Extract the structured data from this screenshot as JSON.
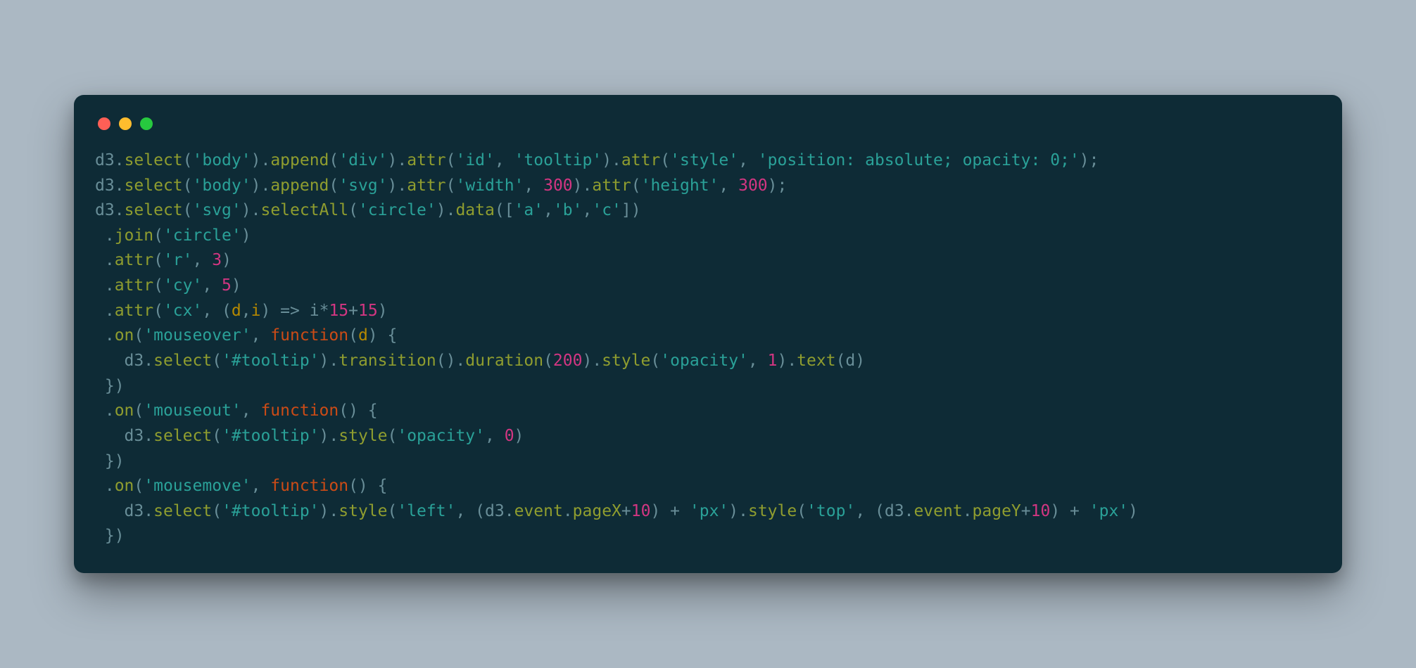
{
  "code": {
    "lines": [
      [
        {
          "c": "id",
          "t": "d3"
        },
        {
          "c": "pn",
          "t": "."
        },
        {
          "c": "fn",
          "t": "select"
        },
        {
          "c": "pn",
          "t": "("
        },
        {
          "c": "str",
          "t": "'body'"
        },
        {
          "c": "pn",
          "t": ")."
        },
        {
          "c": "fn",
          "t": "append"
        },
        {
          "c": "pn",
          "t": "("
        },
        {
          "c": "str",
          "t": "'div'"
        },
        {
          "c": "pn",
          "t": ")."
        },
        {
          "c": "fn",
          "t": "attr"
        },
        {
          "c": "pn",
          "t": "("
        },
        {
          "c": "str",
          "t": "'id'"
        },
        {
          "c": "pn",
          "t": ", "
        },
        {
          "c": "str",
          "t": "'tooltip'"
        },
        {
          "c": "pn",
          "t": ")."
        },
        {
          "c": "fn",
          "t": "attr"
        },
        {
          "c": "pn",
          "t": "("
        },
        {
          "c": "str",
          "t": "'style'"
        },
        {
          "c": "pn",
          "t": ", "
        },
        {
          "c": "str",
          "t": "'position: absolute; opacity: 0;'"
        },
        {
          "c": "pn",
          "t": ");"
        }
      ],
      [
        {
          "c": "id",
          "t": "d3"
        },
        {
          "c": "pn",
          "t": "."
        },
        {
          "c": "fn",
          "t": "select"
        },
        {
          "c": "pn",
          "t": "("
        },
        {
          "c": "str",
          "t": "'body'"
        },
        {
          "c": "pn",
          "t": ")."
        },
        {
          "c": "fn",
          "t": "append"
        },
        {
          "c": "pn",
          "t": "("
        },
        {
          "c": "str",
          "t": "'svg'"
        },
        {
          "c": "pn",
          "t": ")."
        },
        {
          "c": "fn",
          "t": "attr"
        },
        {
          "c": "pn",
          "t": "("
        },
        {
          "c": "str",
          "t": "'width'"
        },
        {
          "c": "pn",
          "t": ", "
        },
        {
          "c": "num",
          "t": "300"
        },
        {
          "c": "pn",
          "t": ")."
        },
        {
          "c": "fn",
          "t": "attr"
        },
        {
          "c": "pn",
          "t": "("
        },
        {
          "c": "str",
          "t": "'height'"
        },
        {
          "c": "pn",
          "t": ", "
        },
        {
          "c": "num",
          "t": "300"
        },
        {
          "c": "pn",
          "t": ");"
        }
      ],
      [
        {
          "c": "id",
          "t": "d3"
        },
        {
          "c": "pn",
          "t": "."
        },
        {
          "c": "fn",
          "t": "select"
        },
        {
          "c": "pn",
          "t": "("
        },
        {
          "c": "str",
          "t": "'svg'"
        },
        {
          "c": "pn",
          "t": ")."
        },
        {
          "c": "fn",
          "t": "selectAll"
        },
        {
          "c": "pn",
          "t": "("
        },
        {
          "c": "str",
          "t": "'circle'"
        },
        {
          "c": "pn",
          "t": ")."
        },
        {
          "c": "fn",
          "t": "data"
        },
        {
          "c": "pn",
          "t": "(["
        },
        {
          "c": "str",
          "t": "'a'"
        },
        {
          "c": "pn",
          "t": ","
        },
        {
          "c": "str",
          "t": "'b'"
        },
        {
          "c": "pn",
          "t": ","
        },
        {
          "c": "str",
          "t": "'c'"
        },
        {
          "c": "pn",
          "t": "])"
        }
      ],
      [
        {
          "c": "pn",
          "t": " ."
        },
        {
          "c": "fn",
          "t": "join"
        },
        {
          "c": "pn",
          "t": "("
        },
        {
          "c": "str",
          "t": "'circle'"
        },
        {
          "c": "pn",
          "t": ")"
        }
      ],
      [
        {
          "c": "pn",
          "t": " ."
        },
        {
          "c": "fn",
          "t": "attr"
        },
        {
          "c": "pn",
          "t": "("
        },
        {
          "c": "str",
          "t": "'r'"
        },
        {
          "c": "pn",
          "t": ", "
        },
        {
          "c": "num",
          "t": "3"
        },
        {
          "c": "pn",
          "t": ")"
        }
      ],
      [
        {
          "c": "pn",
          "t": " ."
        },
        {
          "c": "fn",
          "t": "attr"
        },
        {
          "c": "pn",
          "t": "("
        },
        {
          "c": "str",
          "t": "'cy'"
        },
        {
          "c": "pn",
          "t": ", "
        },
        {
          "c": "num",
          "t": "5"
        },
        {
          "c": "pn",
          "t": ")"
        }
      ],
      [
        {
          "c": "pn",
          "t": " ."
        },
        {
          "c": "fn",
          "t": "attr"
        },
        {
          "c": "pn",
          "t": "("
        },
        {
          "c": "str",
          "t": "'cx'"
        },
        {
          "c": "pn",
          "t": ", ("
        },
        {
          "c": "v",
          "t": "d"
        },
        {
          "c": "pn",
          "t": ","
        },
        {
          "c": "v",
          "t": "i"
        },
        {
          "c": "pn",
          "t": ") "
        },
        {
          "c": "arw",
          "t": "=>"
        },
        {
          "c": "pn",
          "t": " "
        },
        {
          "c": "id",
          "t": "i"
        },
        {
          "c": "op",
          "t": "*"
        },
        {
          "c": "num",
          "t": "15"
        },
        {
          "c": "op",
          "t": "+"
        },
        {
          "c": "num",
          "t": "15"
        },
        {
          "c": "pn",
          "t": ")"
        }
      ],
      [
        {
          "c": "pn",
          "t": " ."
        },
        {
          "c": "fn",
          "t": "on"
        },
        {
          "c": "pn",
          "t": "("
        },
        {
          "c": "str",
          "t": "'mouseover'"
        },
        {
          "c": "pn",
          "t": ", "
        },
        {
          "c": "kw",
          "t": "function"
        },
        {
          "c": "pn",
          "t": "("
        },
        {
          "c": "v",
          "t": "d"
        },
        {
          "c": "pn",
          "t": ") {"
        }
      ],
      [
        {
          "c": "pn",
          "t": "   "
        },
        {
          "c": "id",
          "t": "d3"
        },
        {
          "c": "pn",
          "t": "."
        },
        {
          "c": "fn",
          "t": "select"
        },
        {
          "c": "pn",
          "t": "("
        },
        {
          "c": "str",
          "t": "'#tooltip'"
        },
        {
          "c": "pn",
          "t": ")."
        },
        {
          "c": "fn",
          "t": "transition"
        },
        {
          "c": "pn",
          "t": "()."
        },
        {
          "c": "fn",
          "t": "duration"
        },
        {
          "c": "pn",
          "t": "("
        },
        {
          "c": "num",
          "t": "200"
        },
        {
          "c": "pn",
          "t": ")."
        },
        {
          "c": "fn",
          "t": "style"
        },
        {
          "c": "pn",
          "t": "("
        },
        {
          "c": "str",
          "t": "'opacity'"
        },
        {
          "c": "pn",
          "t": ", "
        },
        {
          "c": "num",
          "t": "1"
        },
        {
          "c": "pn",
          "t": ")."
        },
        {
          "c": "fn",
          "t": "text"
        },
        {
          "c": "pn",
          "t": "("
        },
        {
          "c": "id",
          "t": "d"
        },
        {
          "c": "pn",
          "t": ")"
        }
      ],
      [
        {
          "c": "pn",
          "t": " })"
        }
      ],
      [
        {
          "c": "pn",
          "t": " ."
        },
        {
          "c": "fn",
          "t": "on"
        },
        {
          "c": "pn",
          "t": "("
        },
        {
          "c": "str",
          "t": "'mouseout'"
        },
        {
          "c": "pn",
          "t": ", "
        },
        {
          "c": "kw",
          "t": "function"
        },
        {
          "c": "pn",
          "t": "() {"
        }
      ],
      [
        {
          "c": "pn",
          "t": "   "
        },
        {
          "c": "id",
          "t": "d3"
        },
        {
          "c": "pn",
          "t": "."
        },
        {
          "c": "fn",
          "t": "select"
        },
        {
          "c": "pn",
          "t": "("
        },
        {
          "c": "str",
          "t": "'#tooltip'"
        },
        {
          "c": "pn",
          "t": ")."
        },
        {
          "c": "fn",
          "t": "style"
        },
        {
          "c": "pn",
          "t": "("
        },
        {
          "c": "str",
          "t": "'opacity'"
        },
        {
          "c": "pn",
          "t": ", "
        },
        {
          "c": "num",
          "t": "0"
        },
        {
          "c": "pn",
          "t": ")"
        }
      ],
      [
        {
          "c": "pn",
          "t": " })"
        }
      ],
      [
        {
          "c": "pn",
          "t": " ."
        },
        {
          "c": "fn",
          "t": "on"
        },
        {
          "c": "pn",
          "t": "("
        },
        {
          "c": "str",
          "t": "'mousemove'"
        },
        {
          "c": "pn",
          "t": ", "
        },
        {
          "c": "kw",
          "t": "function"
        },
        {
          "c": "pn",
          "t": "() {"
        }
      ],
      [
        {
          "c": "pn",
          "t": "   "
        },
        {
          "c": "id",
          "t": "d3"
        },
        {
          "c": "pn",
          "t": "."
        },
        {
          "c": "fn",
          "t": "select"
        },
        {
          "c": "pn",
          "t": "("
        },
        {
          "c": "str",
          "t": "'#tooltip'"
        },
        {
          "c": "pn",
          "t": ")."
        },
        {
          "c": "fn",
          "t": "style"
        },
        {
          "c": "pn",
          "t": "("
        },
        {
          "c": "str",
          "t": "'left'"
        },
        {
          "c": "pn",
          "t": ", ("
        },
        {
          "c": "id",
          "t": "d3"
        },
        {
          "c": "pn",
          "t": "."
        },
        {
          "c": "fn",
          "t": "event"
        },
        {
          "c": "pn",
          "t": "."
        },
        {
          "c": "fn",
          "t": "pageX"
        },
        {
          "c": "op",
          "t": "+"
        },
        {
          "c": "num",
          "t": "10"
        },
        {
          "c": "pn",
          "t": ") + "
        },
        {
          "c": "str",
          "t": "'px'"
        },
        {
          "c": "pn",
          "t": ")."
        },
        {
          "c": "fn",
          "t": "style"
        },
        {
          "c": "pn",
          "t": "("
        },
        {
          "c": "str",
          "t": "'top'"
        },
        {
          "c": "pn",
          "t": ", ("
        },
        {
          "c": "id",
          "t": "d3"
        },
        {
          "c": "pn",
          "t": "."
        },
        {
          "c": "fn",
          "t": "event"
        },
        {
          "c": "pn",
          "t": "."
        },
        {
          "c": "fn",
          "t": "pageY"
        },
        {
          "c": "op",
          "t": "+"
        },
        {
          "c": "num",
          "t": "10"
        },
        {
          "c": "pn",
          "t": ") + "
        },
        {
          "c": "str",
          "t": "'px'"
        },
        {
          "c": "pn",
          "t": ")"
        }
      ],
      [
        {
          "c": "pn",
          "t": " })"
        }
      ]
    ]
  }
}
